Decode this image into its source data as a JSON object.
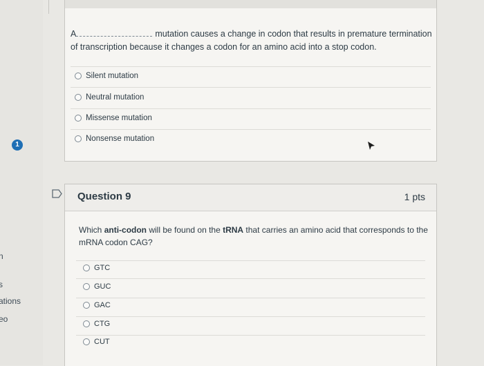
{
  "sidebar": {
    "badge": "1",
    "fragments": [
      "n",
      "s",
      "ations",
      "eo"
    ]
  },
  "question8": {
    "text_prefix": "A",
    "text_rest": "mutation causes a change in codon that results in premature termination of transcription because it changes a codon for an amino acid into a stop codon.",
    "answers": [
      "Silent mutation",
      "Neutral mutation",
      "Missense mutation",
      "Nonsense mutation"
    ]
  },
  "question9": {
    "title": "Question 9",
    "points": "1 pts",
    "text_part1": "Which ",
    "text_bold1": "anti-codon",
    "text_part2": " will be found on the ",
    "text_bold2": "tRNA",
    "text_part3": " that carries an amino acid that corresponds to the mRNA codon CAG?",
    "answers": [
      "GTC",
      "GUC",
      "GAC",
      "CTG",
      "CUT"
    ]
  },
  "colors": {
    "badge": "#1f6fb5",
    "accent": "#2d3b45"
  }
}
